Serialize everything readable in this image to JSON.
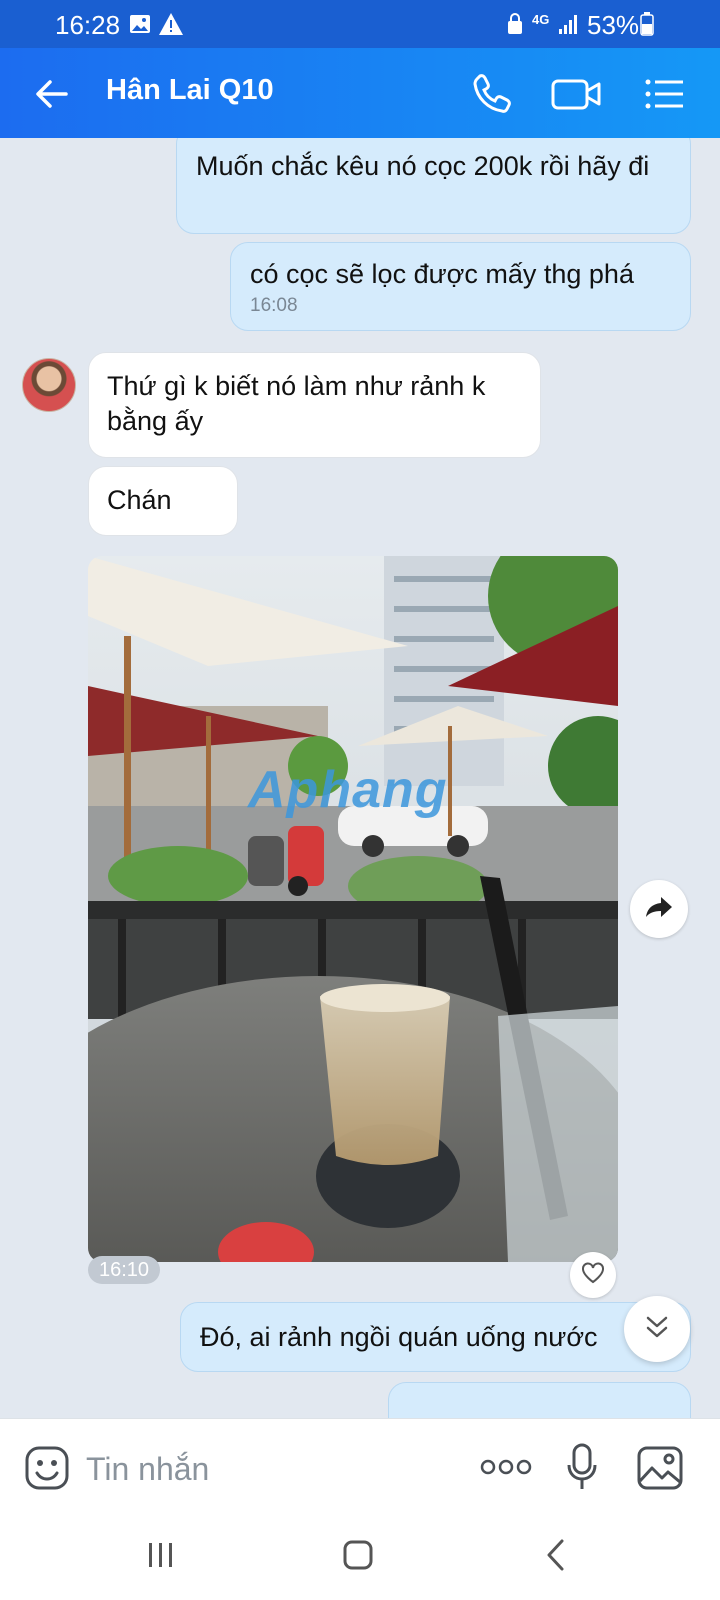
{
  "status_bar": {
    "time": "16:28",
    "network": "4G",
    "battery": "53%"
  },
  "header": {
    "contact_name": "Hân Lai Q10",
    "icons": [
      "back-arrow-icon",
      "phone-icon",
      "video-icon",
      "menu-list-icon"
    ]
  },
  "messages": [
    {
      "direction": "out",
      "text": "Muốn chắc kêu nó cọc 200k rồi hãy đi"
    },
    {
      "direction": "out",
      "text": "có cọc sẽ lọc được mấy thg phá",
      "time": "16:08"
    },
    {
      "direction": "in",
      "text": "Thứ gì k biết nó làm như rảnh k bằng ấy"
    },
    {
      "direction": "in",
      "text": "Chán"
    },
    {
      "direction": "in",
      "type": "photo",
      "watermark": "Aphang",
      "time": "16:10"
    },
    {
      "direction": "out",
      "text": "Đó, ai rảnh ngồi quán uống nước"
    }
  ],
  "input": {
    "placeholder": "Tin nhắn",
    "icons": [
      "sticker-icon",
      "more-icon",
      "microphone-icon",
      "image-icon"
    ]
  },
  "colors": {
    "header_start": "#1c6cf0",
    "header_end": "#1598f6",
    "outgoing_bubble": "#d5ebfc",
    "incoming_bubble": "#ffffff",
    "chat_background": "#e2e8f0"
  }
}
